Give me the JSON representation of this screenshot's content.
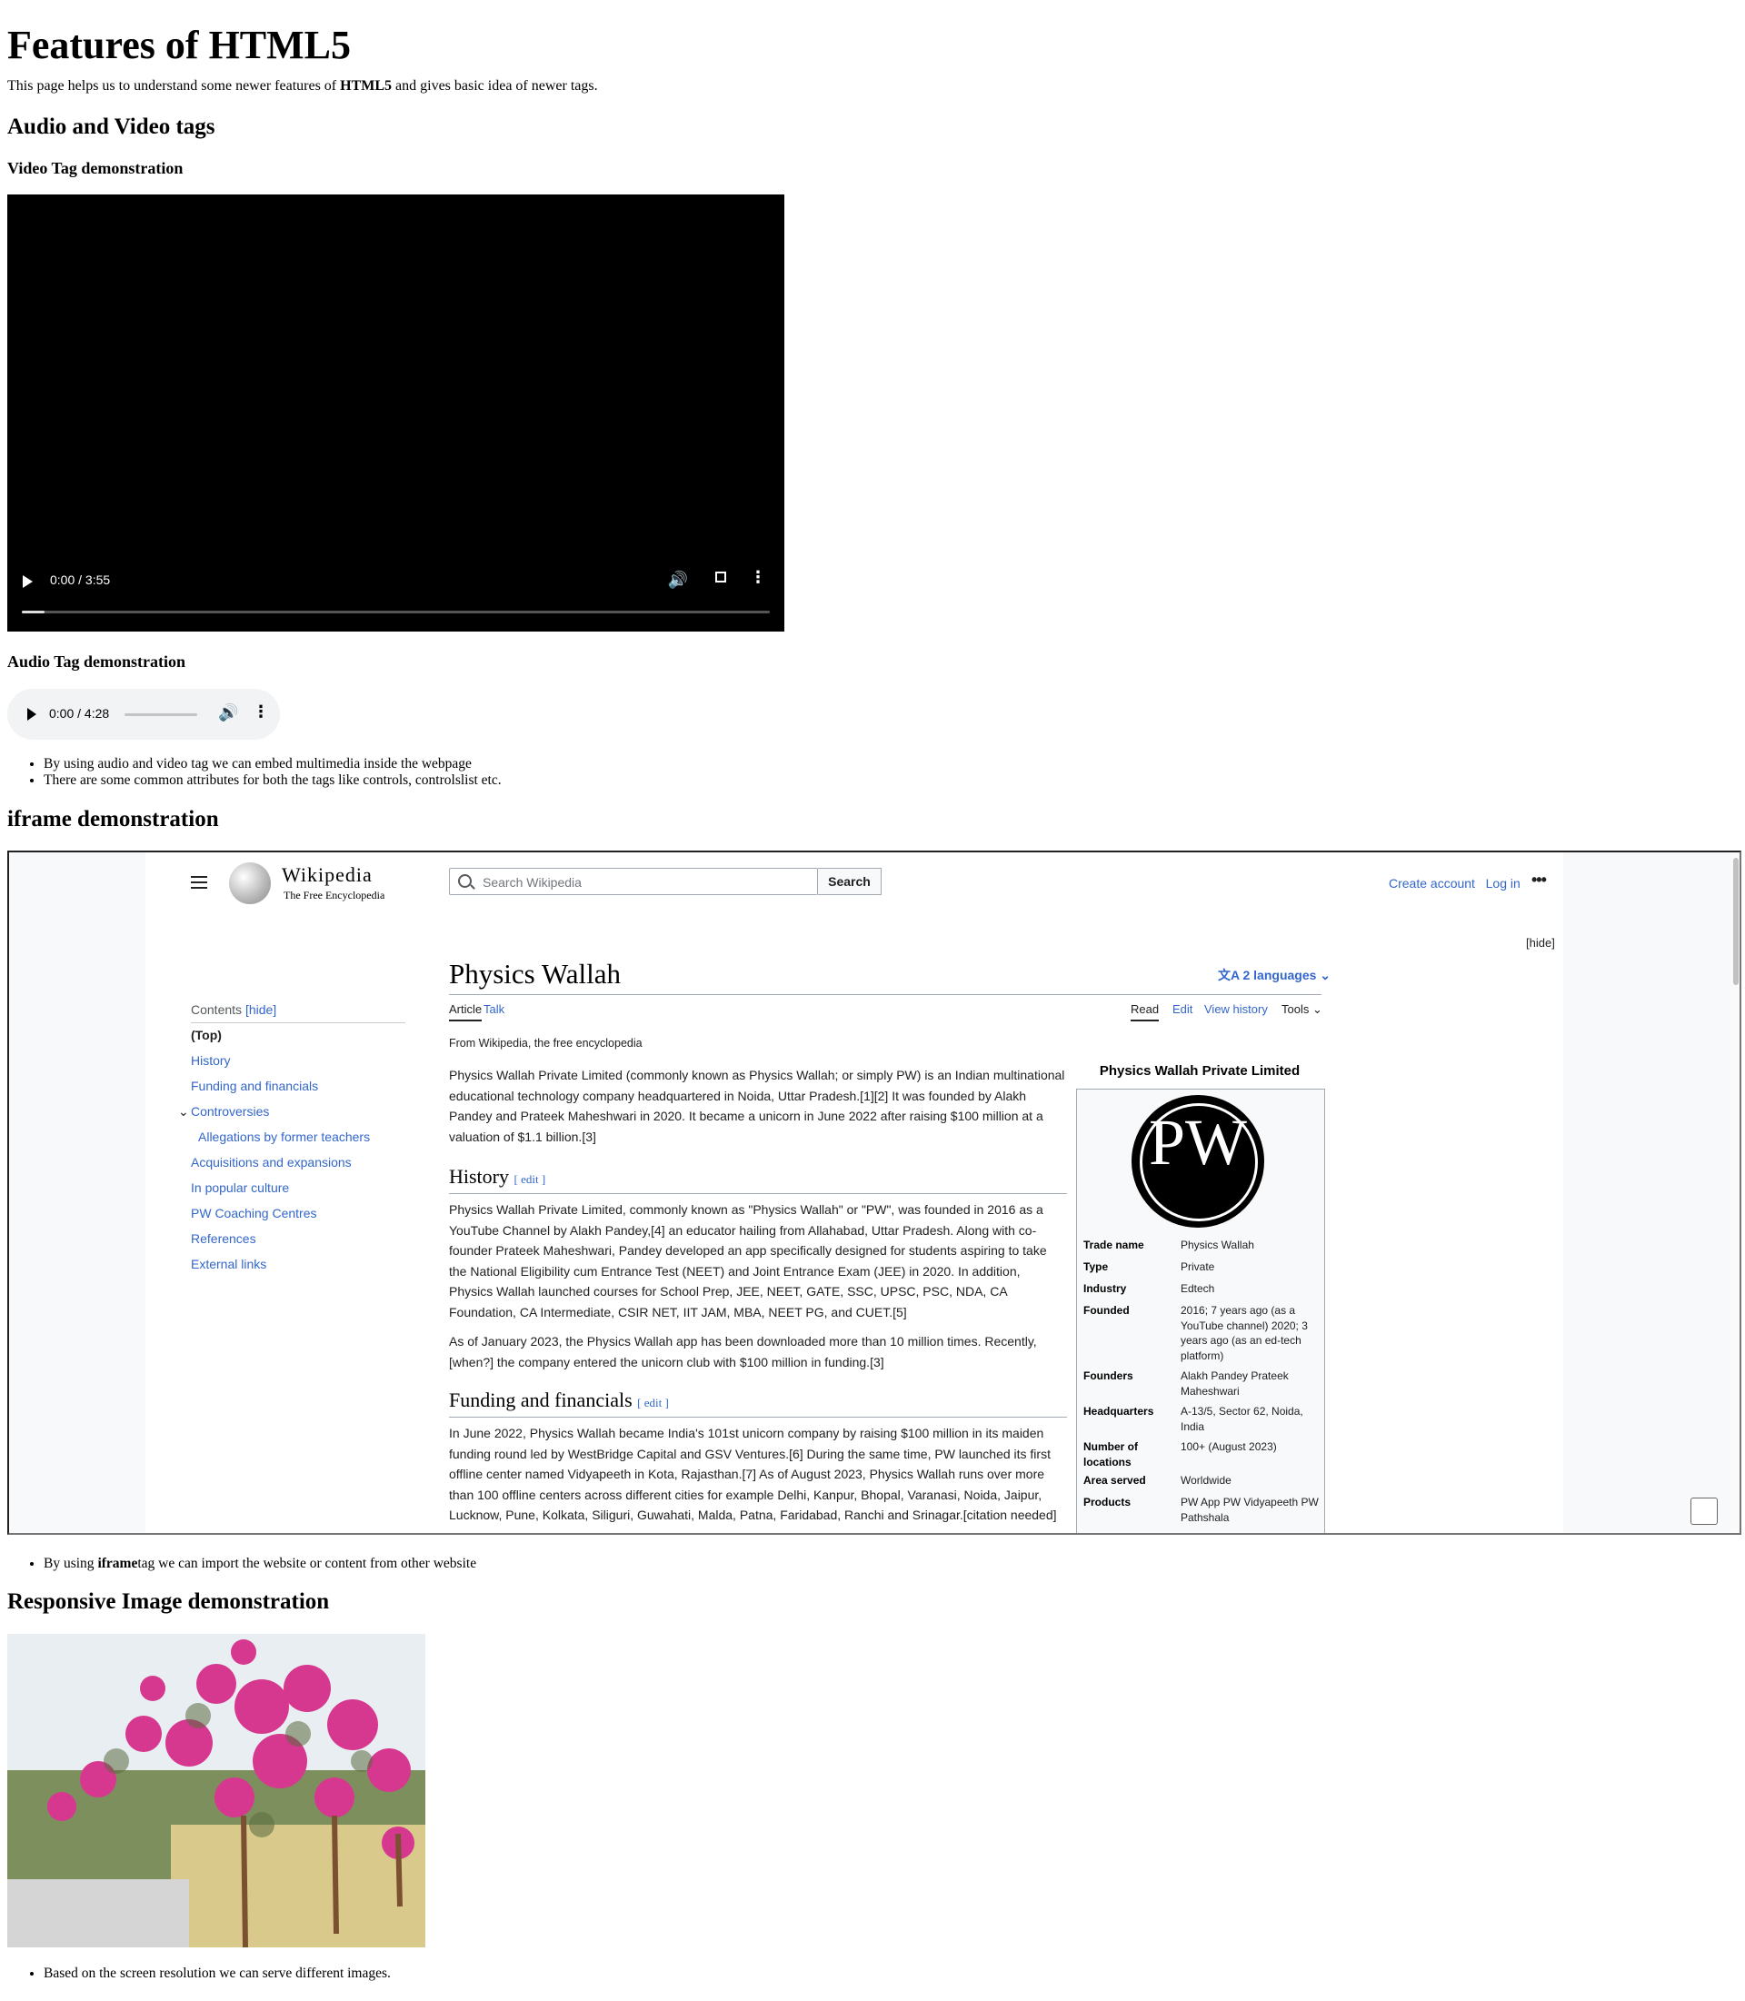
{
  "title": "Features of HTML5",
  "intro": {
    "prefix": "This page helps us to understand some newer features of ",
    "bold": "HTML5",
    "suffix": " and gives basic idea of newer tags."
  },
  "av": {
    "heading": "Audio and Video tags",
    "video_heading": "Video Tag demonstration",
    "video_time": "0:00 / 3:55",
    "video_progress": 0.03,
    "audio_heading": "Audio Tag demonstration",
    "audio_time": "0:00 / 4:28",
    "bullets": [
      "By using audio and video tag we can embed multimedia inside the webpage",
      "There are some common attributes for both the tags like controls, controlslist etc."
    ]
  },
  "iframe": {
    "heading": "iframe demonstration",
    "bullet_prefix": "By using ",
    "bullet_bold": "iframe",
    "bullet_suffix": "tag we can import the website or content from other website",
    "wiki": {
      "logo": "Wikipedia",
      "tagline": "The Free Encyclopedia",
      "search_placeholder": "Search Wikipedia",
      "search_button": "Search",
      "create_account": "Create account",
      "login": "Log in",
      "hide": "[hide]",
      "article_title": "Physics Wallah",
      "languages": "2 languages",
      "tabs_left": [
        "Article",
        "Talk"
      ],
      "tabs_right": [
        "Read",
        "Edit",
        "View history",
        "Tools"
      ],
      "from": "From Wikipedia, the free encyclopedia",
      "contents_label": "Contents",
      "contents_hide": "[hide]",
      "toc": [
        "(Top)",
        "History",
        "Funding and financials",
        "Controversies",
        "Allegations by former teachers",
        "Acquisitions and expansions",
        "In popular culture",
        "PW Coaching Centres",
        "References",
        "External links"
      ],
      "lead": "Physics Wallah Private Limited (commonly known as Physics Wallah; or simply PW) is an Indian multinational educational technology company headquartered in Noida, Uttar Pradesh.[1][2] It was founded by Alakh Pandey and Prateek Maheshwari in 2020. It became a unicorn in June 2022 after raising $100 million at a valuation of $1.1 billion.[3]",
      "history_heading": "History",
      "edit_label": "[ edit ]",
      "history_p1": "Physics Wallah Private Limited, commonly known as \"Physics Wallah\" or \"PW\", was founded in 2016 as a YouTube Channel by Alakh Pandey,[4] an educator hailing from Allahabad, Uttar Pradesh. Along with co-founder Prateek Maheshwari, Pandey developed an app specifically designed for students aspiring to take the National Eligibility cum Entrance Test (NEET) and Joint Entrance Exam (JEE) in 2020. In addition, Physics Wallah launched courses for School Prep, JEE, NEET, GATE, SSC, UPSC, PSC, NDA, CA Foundation, CA Intermediate, CSIR NET, IIT JAM, MBA, NEET PG, and CUET.[5]",
      "history_p2": "As of January 2023, the Physics Wallah app has been downloaded more than 10 million times. Recently,[when?] the company entered the unicorn club with $100 million in funding.[3]",
      "funding_heading": "Funding and financials",
      "funding_p": "In June 2022, Physics Wallah became India's 101st unicorn company by raising $100 million in its maiden funding round led by WestBridge Capital and GSV Ventures.[6] During the same time, PW launched its first offline center named Vidyapeeth in Kota, Rajasthan.[7] As of August 2023, Physics Wallah runs over more than 100 offline centers across different cities for example Delhi, Kanpur, Bhopal, Varanasi, Noida, Jaipur, Lucknow, Pune, Kolkata, Siliguri, Guwahati, Malda, Patna, Faridabad, Ranchi and Srinagar.[citation needed]",
      "infobox_title": "Physics Wallah Private Limited",
      "infobox_logo_text": "PW",
      "infobox": [
        {
          "k": "Trade name",
          "v": "Physics Wallah"
        },
        {
          "k": "Type",
          "v": "Private"
        },
        {
          "k": "Industry",
          "v": "Edtech"
        },
        {
          "k": "Founded",
          "v": "2016; 7 years ago (as a YouTube channel) 2020; 3 years ago (as an ed-tech platform)"
        },
        {
          "k": "Founders",
          "v": "Alakh Pandey Prateek Maheshwari"
        },
        {
          "k": "Headquarters",
          "v": "A-13/5, Sector 62, Noida, India"
        },
        {
          "k": "Number of locations",
          "v": "100+ (August 2023)"
        },
        {
          "k": "Area served",
          "v": "Worldwide"
        },
        {
          "k": "Products",
          "v": "PW App PW Vidyapeeth PW Pathshala"
        }
      ]
    }
  },
  "responsive": {
    "heading": "Responsive Image demonstration",
    "bullet": "Based on the screen resolution we can serve different images."
  }
}
